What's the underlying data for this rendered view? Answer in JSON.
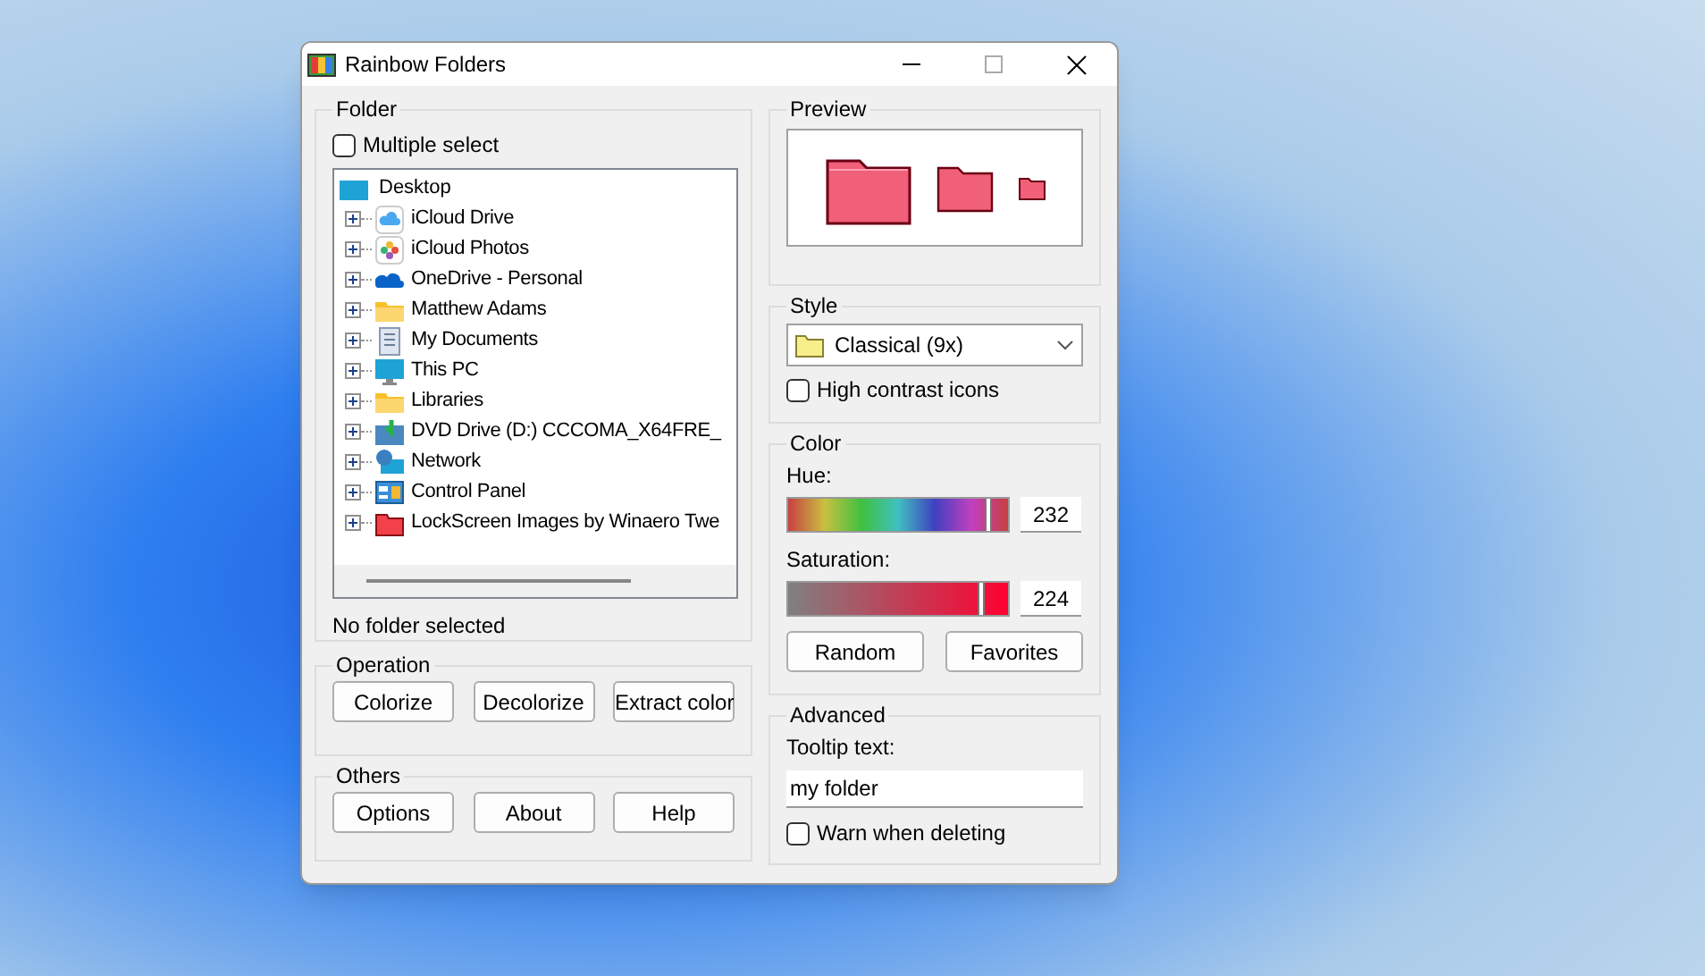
{
  "window": {
    "title": "Rainbow Folders"
  },
  "folder": {
    "title": "Folder",
    "multiple_select": {
      "label": "Multiple select",
      "checked": false
    },
    "tree": [
      {
        "label": "Desktop",
        "kind": "desktop",
        "children": [
          {
            "label": "iCloud Drive",
            "kind": "cloud"
          },
          {
            "label": "iCloud Photos",
            "kind": "photos"
          },
          {
            "label": "OneDrive - Personal",
            "kind": "onedrive"
          },
          {
            "label": "Matthew Adams",
            "kind": "folder"
          },
          {
            "label": "My Documents",
            "kind": "documents"
          },
          {
            "label": "This PC",
            "kind": "pc"
          },
          {
            "label": "Libraries",
            "kind": "folder"
          },
          {
            "label": "DVD Drive (D:) CCCOMA_X64FRE_",
            "kind": "dvd"
          },
          {
            "label": "Network",
            "kind": "network"
          },
          {
            "label": "Control Panel",
            "kind": "control-panel"
          },
          {
            "label": "LockScreen Images by Winaero Twe",
            "kind": "red-folder"
          }
        ]
      }
    ],
    "status": "No folder selected"
  },
  "operation": {
    "title": "Operation",
    "buttons": [
      "Colorize",
      "Decolorize",
      "Extract color"
    ]
  },
  "others": {
    "title": "Others",
    "buttons": [
      "Options",
      "About",
      "Help"
    ]
  },
  "preview": {
    "title": "Preview"
  },
  "style": {
    "title": "Style",
    "value": "Classical (9x)",
    "high_contrast": {
      "label": "High contrast icons",
      "checked": false
    }
  },
  "color": {
    "title": "Color",
    "hue": {
      "label": "Hue:",
      "level": 0.91,
      "value": "232"
    },
    "saturation": {
      "label": "Saturation:",
      "level": 0.88,
      "value": "224"
    },
    "buttons": [
      "Random",
      "Favorites"
    ]
  },
  "advanced": {
    "title": "Advanced",
    "tooltip_label": "Tooltip text:",
    "tooltip_value": "my folder",
    "warn": {
      "label": "Warn when deleting",
      "checked": false
    }
  }
}
